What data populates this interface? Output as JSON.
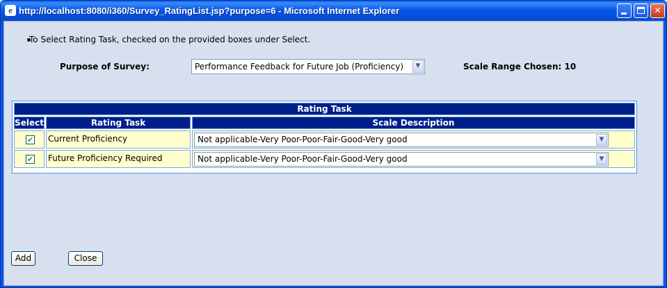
{
  "window": {
    "title": "http://localhost:8080/i360/Survey_RatingList.jsp?purpose=6 - Microsoft Internet Explorer",
    "icon": "ie-icon"
  },
  "instruction": "To Select Rating Task, checked on the provided boxes under Select.",
  "purpose": {
    "label": "Purpose of Survey:",
    "selected": "Performance Feedback for Future Job (Proficiency)"
  },
  "scale_range": "Scale Range Chosen: 10",
  "table": {
    "title": "Rating Task",
    "headers": [
      "Select",
      "Rating Task",
      "Scale Description"
    ],
    "rows": [
      {
        "checked": true,
        "task": "Current Proficiency",
        "scale": "Not applicable-Very Poor-Poor-Fair-Good-Very good"
      },
      {
        "checked": true,
        "task": "Future Proficiency Required",
        "scale": "Not applicable-Very Poor-Poor-Fair-Good-Very good"
      }
    ]
  },
  "buttons": {
    "add": "Add",
    "close": "Close"
  }
}
